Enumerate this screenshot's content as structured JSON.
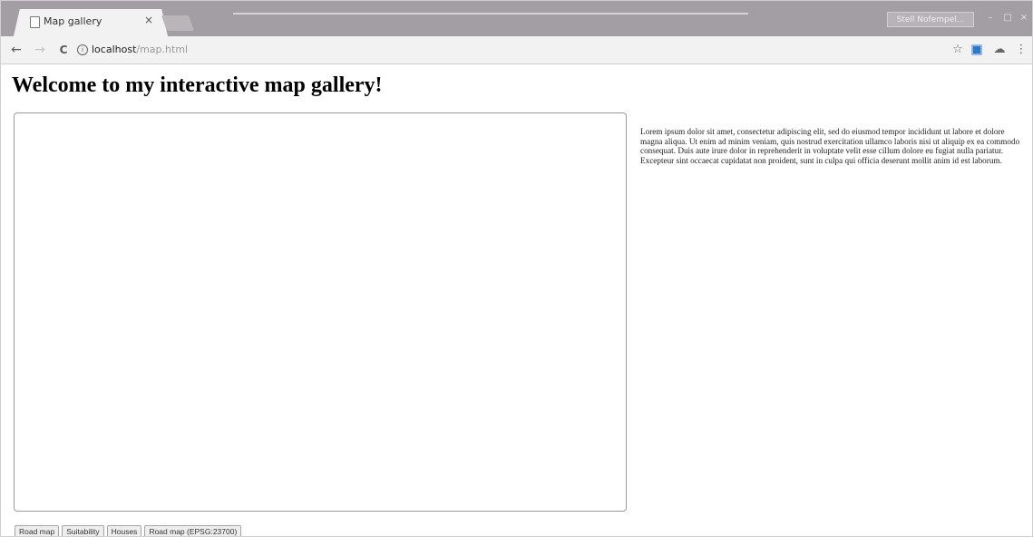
{
  "browser": {
    "tab": {
      "title": "Map gallery",
      "close_glyph": "×",
      "icon": "page-icon"
    },
    "profile_label": "Stell Nofempel...",
    "window_controls": [
      "–",
      "□",
      "×"
    ],
    "nav": {
      "back_glyph": "←",
      "forward_glyph": "→",
      "reload_glyph": "C"
    },
    "address": {
      "info_glyph": "i",
      "host": "localhost",
      "path": "/map.html"
    },
    "toolbar_icons": {
      "star": "☆",
      "extension_color": "#2f76c9",
      "extra": "☁",
      "menu": "⋮"
    }
  },
  "page": {
    "title": "Welcome to my interactive map gallery!",
    "description": "Lorem ipsum dolor sit amet, consectetur adipiscing elit, sed do eiusmod tempor incididunt ut labore et dolore magna aliqua. Ut enim ad minim veniam, quis nostrud exercitation ullamco laboris nisi ut aliquip ex ea commodo consequat. Duis aute irure dolor in reprehenderit in voluptate velit esse cillum dolore eu fugiat nulla pariatur. Excepteur sint occaecat cupidatat non proident, sunt in culpa qui officia deserunt mollit anim id est laborum.",
    "layer_buttons": [
      "Road map",
      "Suitability",
      "Houses",
      "Road map (EPSG:23700)"
    ]
  },
  "colors": {
    "tabstrip": "#a39ea3",
    "toolbar": "#f3f2f2",
    "map_border": "#9a9a9a"
  }
}
